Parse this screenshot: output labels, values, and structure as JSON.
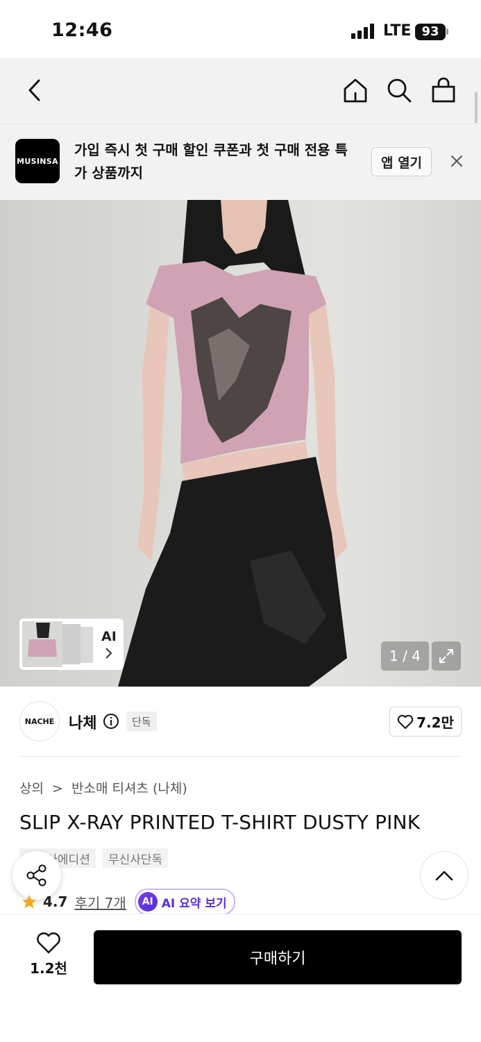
{
  "status_bar": {
    "time": "12:46",
    "network": "LTE",
    "battery": "93"
  },
  "banner": {
    "logo": "MUSINSA",
    "text": "가입 즉시 첫 구매 할인 쿠폰과 첫 구매 전용 특가 상품까지",
    "open_app": "앱 열기"
  },
  "gallery": {
    "thumb_label": "AI",
    "counter": "1 / 4"
  },
  "brand": {
    "logo": "NACHE",
    "name": "나체",
    "badge": "단독",
    "likes": "7.2만"
  },
  "breadcrumb": {
    "category": "상의",
    "separator": ">",
    "subcategory": "반소매 티셔츠 (나체)"
  },
  "product": {
    "title": "SLIP X-RAY PRINTED T-SHIRT DUSTY PINK",
    "tags": [
      "무신사에디션",
      "무신사단독"
    ],
    "rating": "4.7",
    "reviews": "후기 7개",
    "ai_badge": "AI",
    "ai_summary": "AI 요약 보기"
  },
  "bottom_bar": {
    "wish_count": "1.2천",
    "buy_label": "구매하기"
  },
  "colors": {
    "primary": "#000000",
    "ai_accent": "#5a2fd6",
    "star": "#f5a623",
    "shirt": "#cfa3b3"
  }
}
